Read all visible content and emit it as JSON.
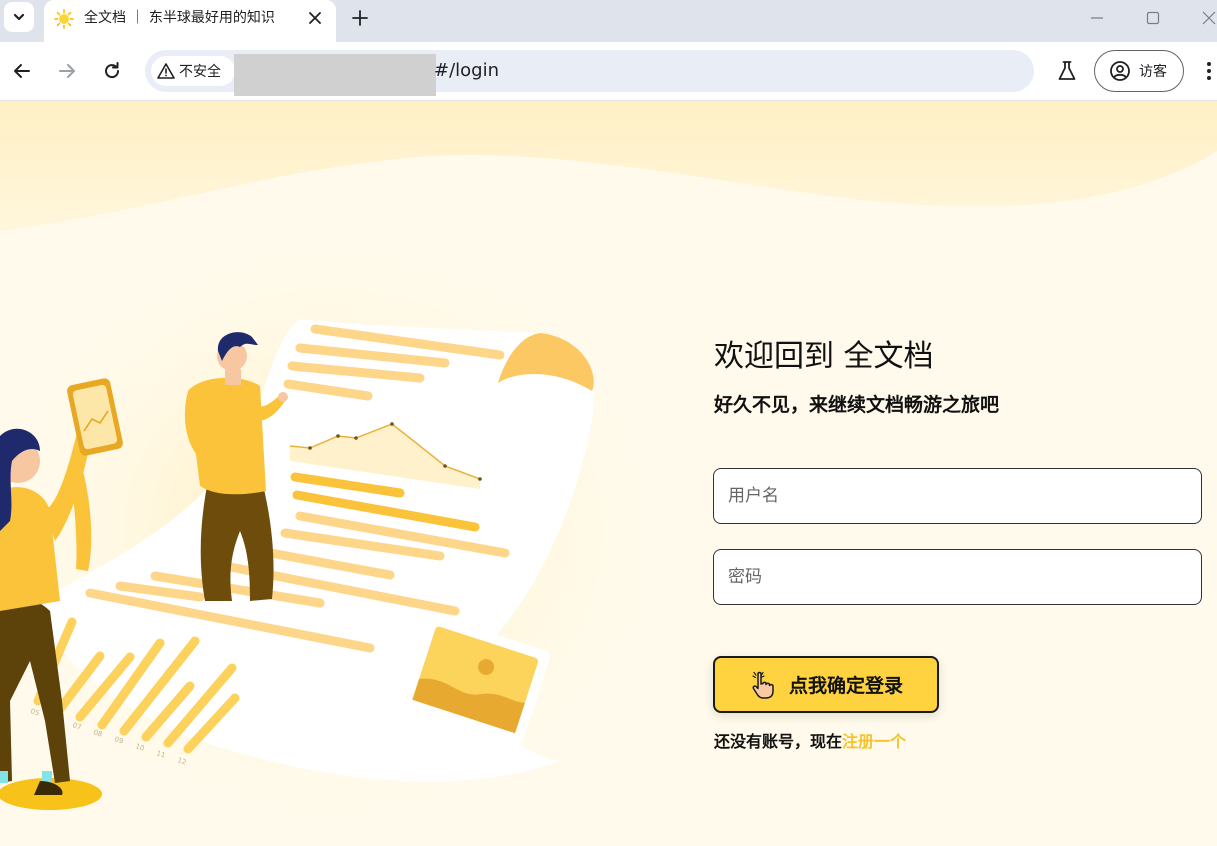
{
  "browser": {
    "tab": {
      "title": "全文档 ｜ 东半球最好用的知识",
      "favicon": "sun-icon"
    },
    "address_bar": {
      "security_label": "不安全",
      "url_suffix": "#/login"
    },
    "profile": {
      "label": "访客"
    }
  },
  "login": {
    "title": "欢迎回到 全文档",
    "subtitle": "好久不见，来继续文档畅游之旅吧",
    "username_placeholder": "用户名",
    "password_placeholder": "密码",
    "submit_label": "点我确定登录",
    "register_prompt": "还没有账号，现在",
    "register_link": "注册一个"
  },
  "illustration": {
    "axis_labels": [
      "05",
      "06",
      "07",
      "08",
      "09",
      "10",
      "11",
      "12"
    ]
  },
  "colors": {
    "accent": "#fed33f",
    "link": "#f5c32c",
    "page_background": "#fffaeb"
  }
}
